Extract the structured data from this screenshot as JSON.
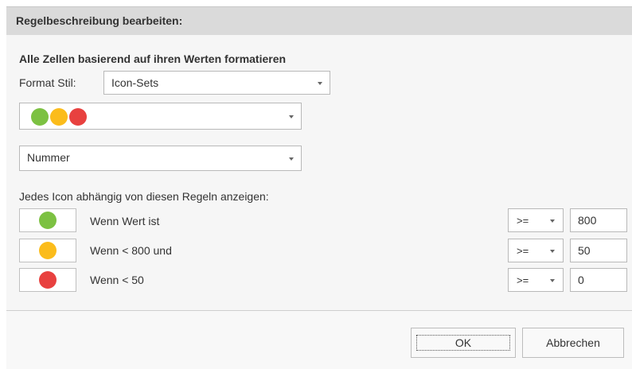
{
  "header": {
    "title": "Regelbeschreibung bearbeiten:"
  },
  "section": {
    "title": "Alle Zellen basierend auf ihren Werten formatieren"
  },
  "format_style": {
    "label": "Format Stil:",
    "value": "Icon-Sets"
  },
  "icon_set": {
    "icons": [
      "green-circle-icon",
      "yellow-circle-icon",
      "red-circle-icon"
    ]
  },
  "type_select": {
    "value": "Nummer"
  },
  "rules": {
    "heading": "Jedes Icon abhängig von diesen Regeln anzeigen:",
    "items": [
      {
        "icon": "green-circle-icon",
        "color": "#7cc142",
        "label": "Wenn Wert ist",
        "operator": ">=",
        "value": "800"
      },
      {
        "icon": "yellow-circle-icon",
        "color": "#fbbc1b",
        "label": "Wenn < 800 und",
        "operator": ">=",
        "value": "50"
      },
      {
        "icon": "red-circle-icon",
        "color": "#e8413f",
        "label": "Wenn < 50",
        "operator": ">=",
        "value": "0"
      }
    ]
  },
  "buttons": {
    "ok": "OK",
    "cancel": "Abbrechen"
  },
  "colors": {
    "green": "#7cc142",
    "yellow": "#fbbc1b",
    "red": "#e8413f",
    "header_bg": "#dadada"
  }
}
